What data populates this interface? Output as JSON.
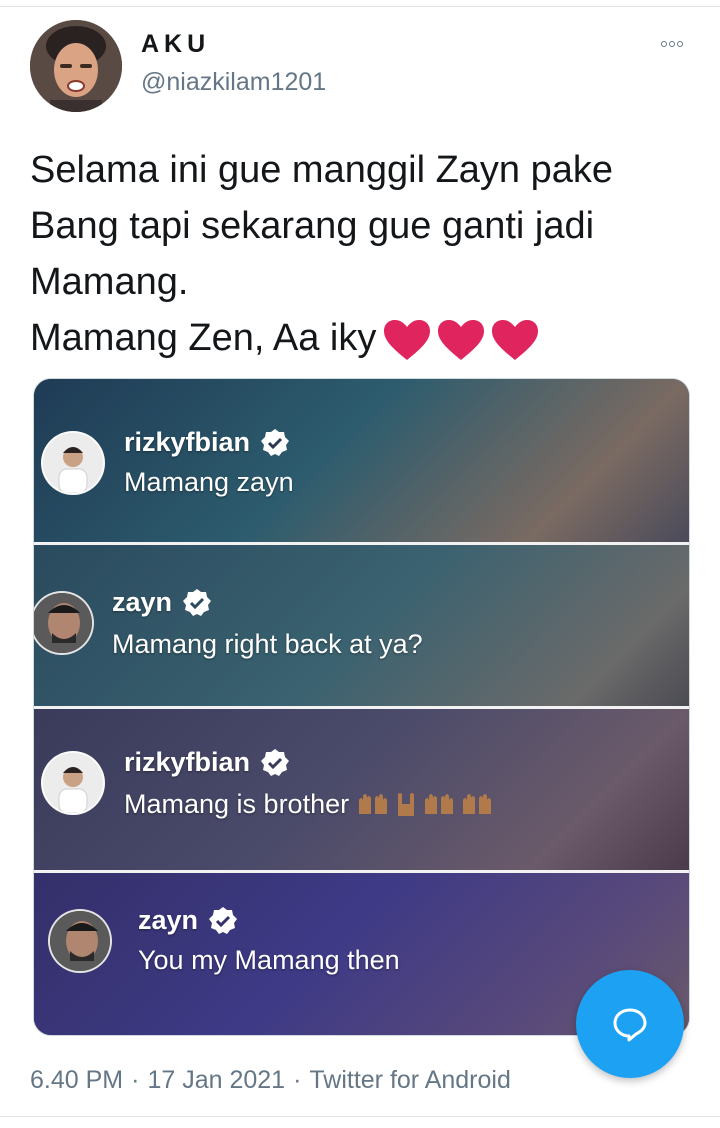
{
  "author": {
    "display_name": "AKU",
    "handle": "@niazkilam1201"
  },
  "tweet": {
    "text": "Selama ini gue manggil Zayn pake\nBang tapi sekarang gue ganti jadi\nMamang.\nMamang Zen, Aa iky",
    "hearts": [
      "heart-icon",
      "heart-icon",
      "heart-icon"
    ]
  },
  "media": {
    "comments": [
      {
        "user": "rizkyfbian",
        "text": "Mamang zayn",
        "verified": true
      },
      {
        "user": "zayn",
        "text": "Mamang right back at ya?",
        "verified": true
      },
      {
        "user": "rizkyfbian",
        "text": "Mamang is brother",
        "verified": true,
        "emojis": [
          "raised-hands-icon",
          "rock-on-hand-icon",
          "raised-hands-icon",
          "raised-hands-icon"
        ]
      },
      {
        "user": "zayn",
        "text": "You my Mamang then",
        "verified": true
      }
    ]
  },
  "footer": {
    "time": "6.40 PM",
    "date": "17 Jan 2021",
    "client": "Twitter for Android"
  },
  "colors": {
    "link_blue": "#1da1f2",
    "secondary_text": "#657786",
    "heart_red": "#e0245e"
  }
}
